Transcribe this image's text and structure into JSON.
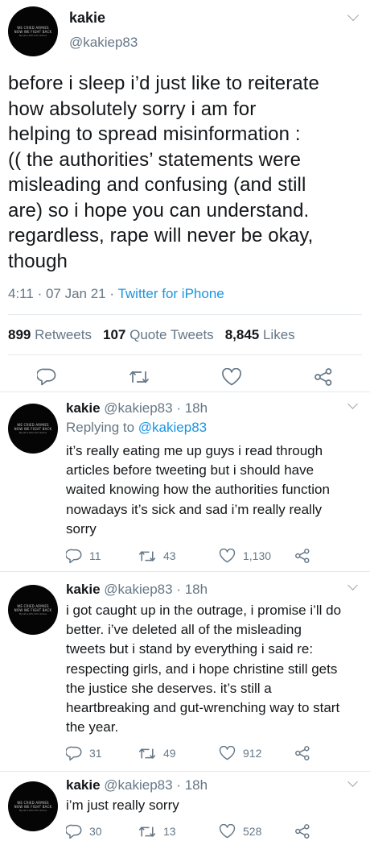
{
  "avatar": {
    "line1": "WE CRIED ARMIES",
    "line2": "NOW WE FIGHT BACK",
    "line3": "#JusticeForChristine"
  },
  "main_tweet": {
    "name": "kakie",
    "handle": "@kakiep83",
    "text_lines": [
      "before i sleep i’d just like to reiterate",
      "how absolutely sorry i am for",
      "helping to spread misinformation :",
      "(( the authorities’ statements were",
      "misleading and confusing (and still",
      "are) so i hope you can understand.",
      "regardless, rape will never be okay,",
      "though"
    ],
    "time": "4:11",
    "date": "07 Jan 21",
    "source": "Twitter for iPhone",
    "retweets": "899",
    "retweets_label": "Retweets",
    "quote_tweets": "107",
    "quote_tweets_label": "Quote Tweets",
    "likes": "8,845",
    "likes_label": "Likes"
  },
  "replies": [
    {
      "name": "kakie",
      "handle": "@kakiep83",
      "age": "18h",
      "replying_label": "Replying to",
      "replying_to": "@kakiep83",
      "text_lines": [
        "it’s really eating me up guys i read through",
        "articles before tweeting but i  should have",
        "waited knowing how the authorities function",
        "nowadays it’s sick and sad i’m really really",
        "sorry"
      ],
      "replies": "11",
      "retweets": "43",
      "likes": "1,130"
    },
    {
      "name": "kakie",
      "handle": "@kakiep83",
      "age": "18h",
      "text_lines": [
        "i got caught up in the outrage, i promise i’ll do",
        "better. i’ve deleted all of the misleading",
        "tweets but i stand by everything i said re:",
        "respecting girls, and i hope christine still gets",
        "the justice she deserves. it’s still a",
        "heartbreaking and gut-wrenching way to start",
        "the year."
      ],
      "replies": "31",
      "retweets": "49",
      "likes": "912"
    },
    {
      "name": "kakie",
      "handle": "@kakiep83",
      "age": "18h",
      "text_lines": [
        "i’m just really sorry"
      ],
      "replies": "30",
      "retweets": "13",
      "likes": "528"
    }
  ],
  "icons": {
    "reply": "reply-icon",
    "retweet": "retweet-icon",
    "like": "heart-icon",
    "share": "share-icon",
    "more": "chevron-down-icon"
  },
  "colors": {
    "link": "#1b95e0",
    "secondary_text": "#657786",
    "primary_text": "#14171a",
    "divider": "#e1e8ed"
  }
}
